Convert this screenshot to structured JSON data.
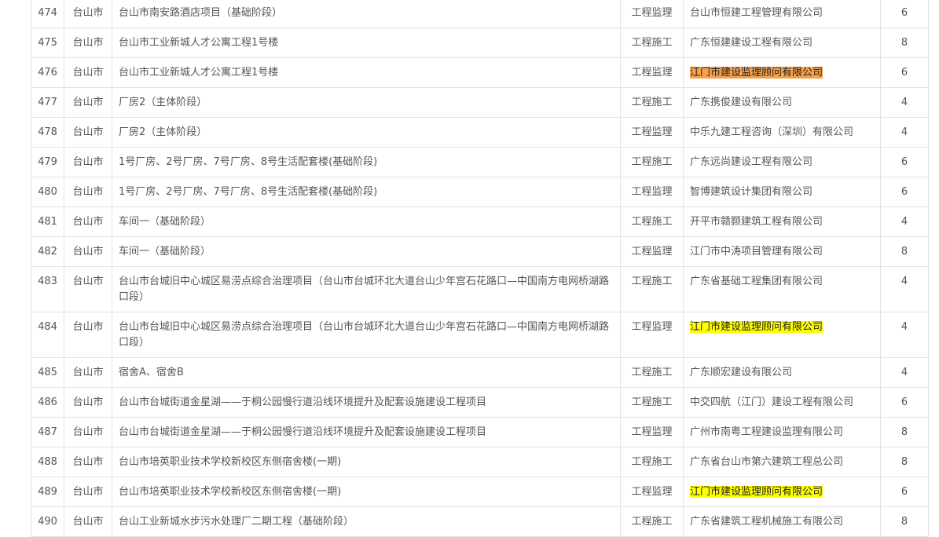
{
  "table": {
    "rows": [
      {
        "no": "474",
        "city": "台山市",
        "project": "台山市南安路酒店项目（基础阶段）",
        "type": "工程监理",
        "company": "台山市恒建工程管理有限公司",
        "count": "6",
        "highlight": ""
      },
      {
        "no": "475",
        "city": "台山市",
        "project": "台山市工业新城人才公寓工程1号楼",
        "type": "工程施工",
        "company": "广东恒建建设工程有限公司",
        "count": "8",
        "highlight": ""
      },
      {
        "no": "476",
        "city": "台山市",
        "project": "台山市工业新城人才公寓工程1号楼",
        "type": "工程监理",
        "company": "江门市建设监理顾问有限公司",
        "count": "6",
        "highlight": "orange"
      },
      {
        "no": "477",
        "city": "台山市",
        "project": "厂房2（主体阶段）",
        "type": "工程施工",
        "company": "广东携俊建设有限公司",
        "count": "4",
        "highlight": ""
      },
      {
        "no": "478",
        "city": "台山市",
        "project": "厂房2（主体阶段）",
        "type": "工程监理",
        "company": "中乐九建工程咨询（深圳）有限公司",
        "count": "4",
        "highlight": ""
      },
      {
        "no": "479",
        "city": "台山市",
        "project": "1号厂房、2号厂房、7号厂房、8号生活配套楼(基础阶段)",
        "type": "工程施工",
        "company": "广东远尚建设工程有限公司",
        "count": "6",
        "highlight": ""
      },
      {
        "no": "480",
        "city": "台山市",
        "project": "1号厂房、2号厂房、7号厂房、8号生活配套楼(基础阶段)",
        "type": "工程监理",
        "company": "智博建筑设计集团有限公司",
        "count": "6",
        "highlight": ""
      },
      {
        "no": "481",
        "city": "台山市",
        "project": "车间一（基础阶段）",
        "type": "工程施工",
        "company": "开平市赣颢建筑工程有限公司",
        "count": "4",
        "highlight": ""
      },
      {
        "no": "482",
        "city": "台山市",
        "project": "车间一（基础阶段）",
        "type": "工程监理",
        "company": "江门市中涛项目管理有限公司",
        "count": "8",
        "highlight": ""
      },
      {
        "no": "483",
        "city": "台山市",
        "project": "台山市台城旧中心城区易涝点综合治理项目（台山市台城环北大道台山少年宫石花路口—中国南方电网桥湖路口段）",
        "type": "工程施工",
        "company": "广东省基础工程集团有限公司",
        "count": "4",
        "highlight": ""
      },
      {
        "no": "484",
        "city": "台山市",
        "project": "台山市台城旧中心城区易涝点综合治理项目（台山市台城环北大道台山少年宫石花路口—中国南方电网桥湖路口段）",
        "type": "工程监理",
        "company": "江门市建设监理顾问有限公司",
        "count": "4",
        "highlight": "yellow"
      },
      {
        "no": "485",
        "city": "台山市",
        "project": "宿舍A、宿舍B",
        "type": "工程施工",
        "company": "广东顺宏建设有限公司",
        "count": "4",
        "highlight": ""
      },
      {
        "no": "486",
        "city": "台山市",
        "project": "台山市台城街道金星湖——于桐公园慢行道沿线环境提升及配套设施建设工程项目",
        "type": "工程施工",
        "company": "中交四航（江门）建设工程有限公司",
        "count": "6",
        "highlight": ""
      },
      {
        "no": "487",
        "city": "台山市",
        "project": "台山市台城街道金星湖——于桐公园慢行道沿线环境提升及配套设施建设工程项目",
        "type": "工程监理",
        "company": "广州市南粤工程建设监理有限公司",
        "count": "8",
        "highlight": ""
      },
      {
        "no": "488",
        "city": "台山市",
        "project": "台山市培英职业技术学校新校区东侧宿舍楼(一期)",
        "type": "工程施工",
        "company": "广东省台山市第六建筑工程总公司",
        "count": "8",
        "highlight": ""
      },
      {
        "no": "489",
        "city": "台山市",
        "project": "台山市培英职业技术学校新校区东侧宿舍楼(一期)",
        "type": "工程监理",
        "company": "江门市建设监理顾问有限公司",
        "count": "6",
        "highlight": "yellow"
      },
      {
        "no": "490",
        "city": "台山市",
        "project": "台山工业新城水步污水处理厂二期工程（基础阶段）",
        "type": "工程施工",
        "company": "广东省建筑工程机械施工有限公司",
        "count": "8",
        "highlight": ""
      }
    ]
  }
}
